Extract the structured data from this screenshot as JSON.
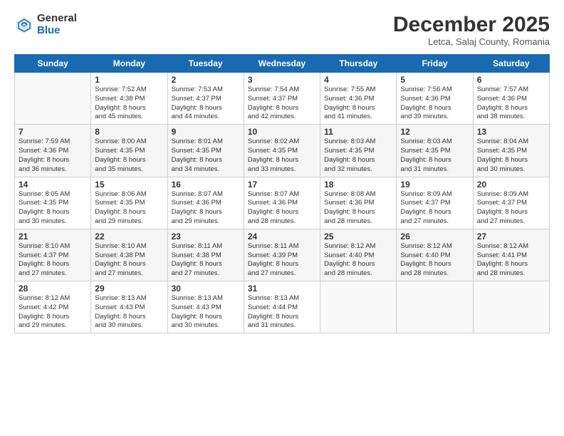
{
  "header": {
    "logo_general": "General",
    "logo_blue": "Blue",
    "month_title": "December 2025",
    "location": "Letca, Salaj County, Romania"
  },
  "days_of_week": [
    "Sunday",
    "Monday",
    "Tuesday",
    "Wednesday",
    "Thursday",
    "Friday",
    "Saturday"
  ],
  "weeks": [
    [
      {
        "num": "",
        "info": ""
      },
      {
        "num": "1",
        "info": "Sunrise: 7:52 AM\nSunset: 4:38 PM\nDaylight: 8 hours\nand 45 minutes."
      },
      {
        "num": "2",
        "info": "Sunrise: 7:53 AM\nSunset: 4:37 PM\nDaylight: 8 hours\nand 44 minutes."
      },
      {
        "num": "3",
        "info": "Sunrise: 7:54 AM\nSunset: 4:37 PM\nDaylight: 8 hours\nand 42 minutes."
      },
      {
        "num": "4",
        "info": "Sunrise: 7:55 AM\nSunset: 4:36 PM\nDaylight: 8 hours\nand 41 minutes."
      },
      {
        "num": "5",
        "info": "Sunrise: 7:56 AM\nSunset: 4:36 PM\nDaylight: 8 hours\nand 39 minutes."
      },
      {
        "num": "6",
        "info": "Sunrise: 7:57 AM\nSunset: 4:36 PM\nDaylight: 8 hours\nand 38 minutes."
      }
    ],
    [
      {
        "num": "7",
        "info": "Sunrise: 7:59 AM\nSunset: 4:36 PM\nDaylight: 8 hours\nand 36 minutes."
      },
      {
        "num": "8",
        "info": "Sunrise: 8:00 AM\nSunset: 4:35 PM\nDaylight: 8 hours\nand 35 minutes."
      },
      {
        "num": "9",
        "info": "Sunrise: 8:01 AM\nSunset: 4:35 PM\nDaylight: 8 hours\nand 34 minutes."
      },
      {
        "num": "10",
        "info": "Sunrise: 8:02 AM\nSunset: 4:35 PM\nDaylight: 8 hours\nand 33 minutes."
      },
      {
        "num": "11",
        "info": "Sunrise: 8:03 AM\nSunset: 4:35 PM\nDaylight: 8 hours\nand 32 minutes."
      },
      {
        "num": "12",
        "info": "Sunrise: 8:03 AM\nSunset: 4:35 PM\nDaylight: 8 hours\nand 31 minutes."
      },
      {
        "num": "13",
        "info": "Sunrise: 8:04 AM\nSunset: 4:35 PM\nDaylight: 8 hours\nand 30 minutes."
      }
    ],
    [
      {
        "num": "14",
        "info": "Sunrise: 8:05 AM\nSunset: 4:35 PM\nDaylight: 8 hours\nand 30 minutes."
      },
      {
        "num": "15",
        "info": "Sunrise: 8:06 AM\nSunset: 4:35 PM\nDaylight: 8 hours\nand 29 minutes."
      },
      {
        "num": "16",
        "info": "Sunrise: 8:07 AM\nSunset: 4:36 PM\nDaylight: 8 hours\nand 29 minutes."
      },
      {
        "num": "17",
        "info": "Sunrise: 8:07 AM\nSunset: 4:36 PM\nDaylight: 8 hours\nand 28 minutes."
      },
      {
        "num": "18",
        "info": "Sunrise: 8:08 AM\nSunset: 4:36 PM\nDaylight: 8 hours\nand 28 minutes."
      },
      {
        "num": "19",
        "info": "Sunrise: 8:09 AM\nSunset: 4:37 PM\nDaylight: 8 hours\nand 27 minutes."
      },
      {
        "num": "20",
        "info": "Sunrise: 8:09 AM\nSunset: 4:37 PM\nDaylight: 8 hours\nand 27 minutes."
      }
    ],
    [
      {
        "num": "21",
        "info": "Sunrise: 8:10 AM\nSunset: 4:37 PM\nDaylight: 8 hours\nand 27 minutes."
      },
      {
        "num": "22",
        "info": "Sunrise: 8:10 AM\nSunset: 4:38 PM\nDaylight: 8 hours\nand 27 minutes."
      },
      {
        "num": "23",
        "info": "Sunrise: 8:11 AM\nSunset: 4:38 PM\nDaylight: 8 hours\nand 27 minutes."
      },
      {
        "num": "24",
        "info": "Sunrise: 8:11 AM\nSunset: 4:39 PM\nDaylight: 8 hours\nand 27 minutes."
      },
      {
        "num": "25",
        "info": "Sunrise: 8:12 AM\nSunset: 4:40 PM\nDaylight: 8 hours\nand 28 minutes."
      },
      {
        "num": "26",
        "info": "Sunrise: 8:12 AM\nSunset: 4:40 PM\nDaylight: 8 hours\nand 28 minutes."
      },
      {
        "num": "27",
        "info": "Sunrise: 8:12 AM\nSunset: 4:41 PM\nDaylight: 8 hours\nand 28 minutes."
      }
    ],
    [
      {
        "num": "28",
        "info": "Sunrise: 8:12 AM\nSunset: 4:42 PM\nDaylight: 8 hours\nand 29 minutes."
      },
      {
        "num": "29",
        "info": "Sunrise: 8:13 AM\nSunset: 4:43 PM\nDaylight: 8 hours\nand 30 minutes."
      },
      {
        "num": "30",
        "info": "Sunrise: 8:13 AM\nSunset: 4:43 PM\nDaylight: 8 hours\nand 30 minutes."
      },
      {
        "num": "31",
        "info": "Sunrise: 8:13 AM\nSunset: 4:44 PM\nDaylight: 8 hours\nand 31 minutes."
      },
      {
        "num": "",
        "info": ""
      },
      {
        "num": "",
        "info": ""
      },
      {
        "num": "",
        "info": ""
      }
    ]
  ]
}
